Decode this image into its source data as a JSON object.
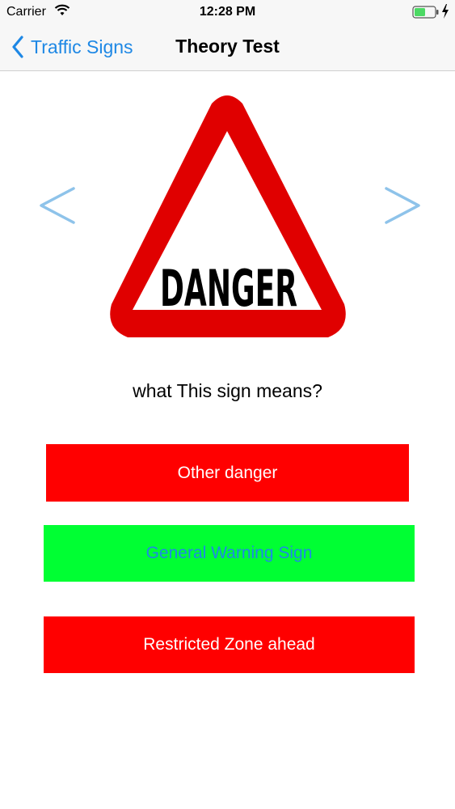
{
  "status_bar": {
    "carrier": "Carrier",
    "time": "12:28 PM",
    "wifi_icon": "wifi-icon",
    "battery_icon": "battery-icon",
    "charging_icon": "bolt-icon"
  },
  "nav": {
    "back_label": "Traffic Signs",
    "title": "Theory Test"
  },
  "sign": {
    "text": "DANGER",
    "icon": "danger-warning-sign"
  },
  "question": "what This sign means?",
  "answers": [
    {
      "label": "Other danger",
      "background": "#ff0000",
      "text_color": "#ffffff"
    },
    {
      "label": "General Warning Sign",
      "background": "#00ff33",
      "text_color": "#1e88e5"
    },
    {
      "label": "Restricted Zone ahead",
      "background": "#ff0000",
      "text_color": "#ffffff"
    }
  ],
  "colors": {
    "accent": "#1e88e5",
    "arrow": "#8ec3ea",
    "sign_red": "#e00000",
    "nav_background": "#f7f7f7"
  }
}
